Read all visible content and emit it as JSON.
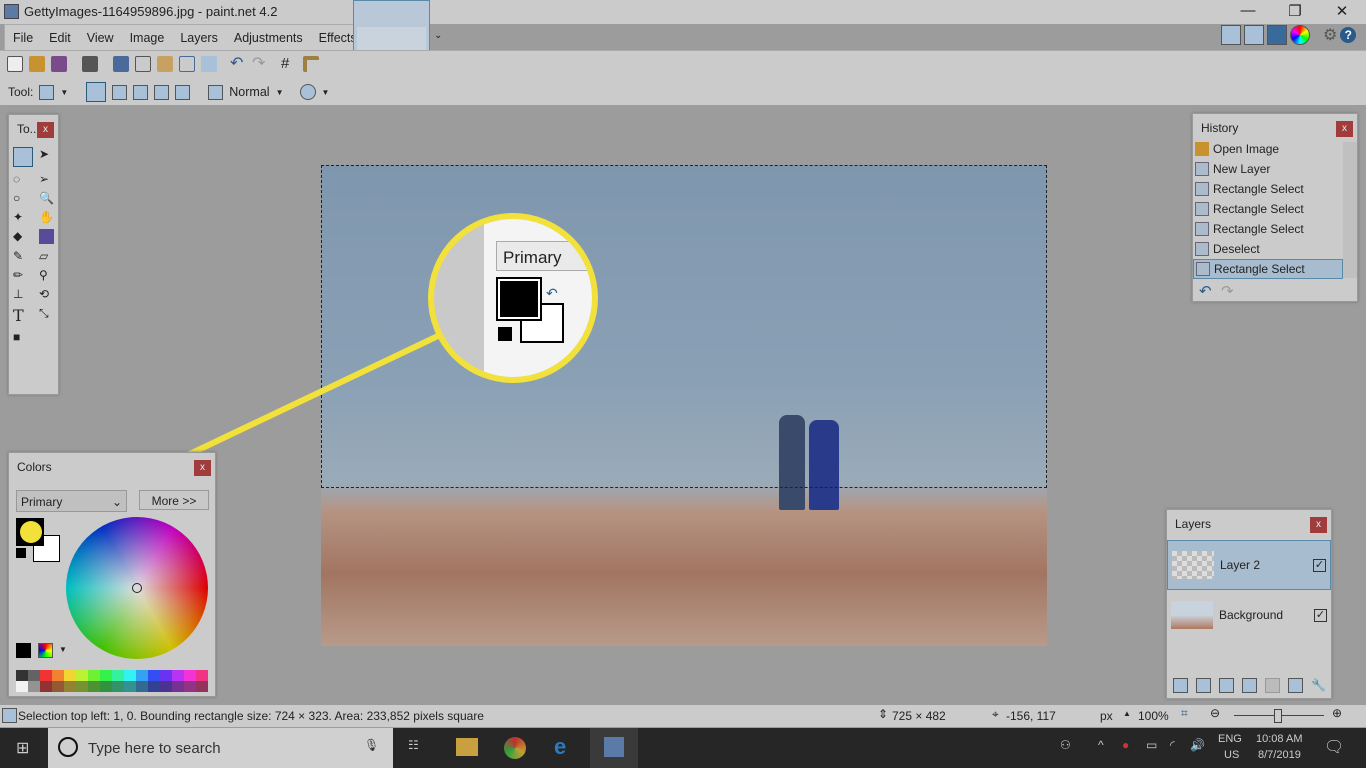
{
  "window": {
    "title": "GettyImages-1164959896.jpg - paint.net 4.2",
    "minimize": "—",
    "restore": "❐",
    "close": "✕"
  },
  "menu": [
    "File",
    "Edit",
    "View",
    "Image",
    "Layers",
    "Adjustments",
    "Effects"
  ],
  "toolbar": {
    "tool_label": "Tool:",
    "blend_mode": "Normal"
  },
  "right_icons": [
    "tools-icon",
    "history-icon",
    "layers-icon",
    "colors-icon",
    "gear-icon",
    "help-icon"
  ],
  "tools_panel": {
    "title": "To...",
    "close": "x"
  },
  "history": {
    "title": "History",
    "close": "x",
    "items": [
      {
        "label": "Open Image",
        "icon": "folder-icon"
      },
      {
        "label": "New Layer",
        "icon": "new-layer-icon"
      },
      {
        "label": "Rectangle Select",
        "icon": "rectangle-select-icon"
      },
      {
        "label": "Rectangle Select",
        "icon": "rectangle-select-icon"
      },
      {
        "label": "Rectangle Select",
        "icon": "rectangle-select-icon"
      },
      {
        "label": "Deselect",
        "icon": "deselect-icon"
      },
      {
        "label": "Rectangle Select",
        "icon": "rectangle-select-icon",
        "selected": true
      }
    ]
  },
  "colors": {
    "title": "Colors",
    "close": "x",
    "mode": "Primary",
    "more": "More >>",
    "primary": "#000000",
    "secondary": "#ffffff",
    "palette_top": [
      "#000000",
      "#404040",
      "#ff0000",
      "#ff6a00",
      "#ffd800",
      "#b6ff00",
      "#4cff00",
      "#00ff21",
      "#00ff90",
      "#00ffff",
      "#0094ff",
      "#0026ff",
      "#4800ff",
      "#b200ff",
      "#ff00dc",
      "#ff006e"
    ],
    "palette_bottom": [
      "#ffffff",
      "#808080",
      "#7f0000",
      "#7f3300",
      "#7f6a00",
      "#5b7f00",
      "#267f00",
      "#007f0e",
      "#007f46",
      "#007f7f",
      "#004a7f",
      "#00137f",
      "#21007f",
      "#57007f",
      "#7f006e",
      "#7f0037"
    ]
  },
  "magnifier": {
    "label": "Primary",
    "highlight": "#f2e13a"
  },
  "layers": {
    "title": "Layers",
    "close": "x",
    "items": [
      {
        "name": "Layer 2",
        "visible": true,
        "selected": true
      },
      {
        "name": "Background",
        "visible": true
      }
    ]
  },
  "status": {
    "selection": "Selection top left: 1, 0. Bounding rectangle size: 724 × 323. Area: 233,852 pixels square",
    "image_size": "725 × 482",
    "cursor": "-156, 117",
    "units": "px",
    "zoom": "100%"
  },
  "taskbar": {
    "search_placeholder": "Type here to search",
    "lang1": "ENG",
    "lang2": "US",
    "time": "10:08 AM",
    "date": "8/7/2019"
  }
}
